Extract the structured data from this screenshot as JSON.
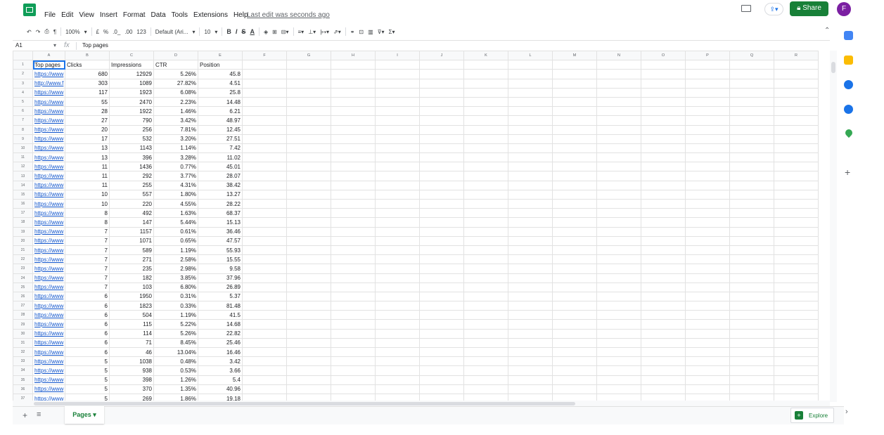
{
  "menu": [
    "File",
    "Edit",
    "View",
    "Insert",
    "Format",
    "Data",
    "Tools",
    "Extensions",
    "Help"
  ],
  "last_edit": "Last edit was seconds ago",
  "share_label": "Share",
  "avatar_letter": "F",
  "toolbar": {
    "zoom": "100%",
    "currency": "£",
    "percent": "%",
    "dec_less": ".0_",
    "dec_more": ".00",
    "format_more": "123",
    "font": "Default (Ari...",
    "size": "10"
  },
  "formula": {
    "cell": "A1",
    "fx": "fx",
    "value": "Top pages"
  },
  "columns": [
    "A",
    "B",
    "C",
    "D",
    "E",
    "F",
    "G",
    "H",
    "I",
    "J",
    "K",
    "L",
    "M",
    "N",
    "O",
    "P",
    "Q",
    "R"
  ],
  "headers": [
    "Top pages",
    "Clicks",
    "Impressions",
    "CTR",
    "Position"
  ],
  "rows": [
    [
      "https://www",
      680,
      12929,
      "5.26%",
      45.8
    ],
    [
      "http://www.f",
      303,
      1089,
      "27.82%",
      4.51
    ],
    [
      "https://www",
      117,
      1923,
      "6.08%",
      25.8
    ],
    [
      "https://www",
      55,
      2470,
      "2.23%",
      14.48
    ],
    [
      "https://www",
      28,
      1922,
      "1.46%",
      6.21
    ],
    [
      "https://www",
      27,
      790,
      "3.42%",
      48.97
    ],
    [
      "https://www",
      20,
      256,
      "7.81%",
      12.45
    ],
    [
      "https://www",
      17,
      532,
      "3.20%",
      27.51
    ],
    [
      "https://www",
      13,
      1143,
      "1.14%",
      7.42
    ],
    [
      "https://www",
      13,
      396,
      "3.28%",
      11.02
    ],
    [
      "https://www",
      11,
      1436,
      "0.77%",
      45.01
    ],
    [
      "https://www",
      11,
      292,
      "3.77%",
      28.07
    ],
    [
      "https://www",
      11,
      255,
      "4.31%",
      38.42
    ],
    [
      "https://www",
      10,
      557,
      "1.80%",
      13.27
    ],
    [
      "https://www",
      10,
      220,
      "4.55%",
      28.22
    ],
    [
      "https://www",
      8,
      492,
      "1.63%",
      68.37
    ],
    [
      "https://www",
      8,
      147,
      "5.44%",
      15.13
    ],
    [
      "https://www",
      7,
      1157,
      "0.61%",
      36.46
    ],
    [
      "https://www",
      7,
      1071,
      "0.65%",
      47.57
    ],
    [
      "https://www",
      7,
      589,
      "1.19%",
      55.93
    ],
    [
      "https://www",
      7,
      271,
      "2.58%",
      15.55
    ],
    [
      "https://www",
      7,
      235,
      "2.98%",
      9.58
    ],
    [
      "https://www",
      7,
      182,
      "3.85%",
      37.96
    ],
    [
      "https://www",
      7,
      103,
      "6.80%",
      26.89
    ],
    [
      "https://www",
      6,
      1950,
      "0.31%",
      5.37
    ],
    [
      "https://www",
      6,
      1823,
      "0.33%",
      81.48
    ],
    [
      "https://www",
      6,
      504,
      "1.19%",
      41.5
    ],
    [
      "https://www",
      6,
      115,
      "5.22%",
      14.68
    ],
    [
      "https://www",
      6,
      114,
      "5.26%",
      22.82
    ],
    [
      "https://www",
      6,
      71,
      "8.45%",
      25.46
    ],
    [
      "https://www",
      6,
      46,
      "13.04%",
      16.46
    ],
    [
      "https://www",
      5,
      1038,
      "0.48%",
      3.42
    ],
    [
      "https://www",
      5,
      938,
      "0.53%",
      3.66
    ],
    [
      "https://www",
      5,
      398,
      "1.26%",
      5.4
    ],
    [
      "https://www",
      5,
      370,
      "1.35%",
      40.96
    ],
    [
      "https://www",
      5,
      269,
      "1.86%",
      19.18
    ]
  ],
  "sheet_tab": "Pages",
  "explore_label": "Explore",
  "colors": {
    "accent": "#188038",
    "link": "#1155cc",
    "selection": "#1a73e8"
  }
}
